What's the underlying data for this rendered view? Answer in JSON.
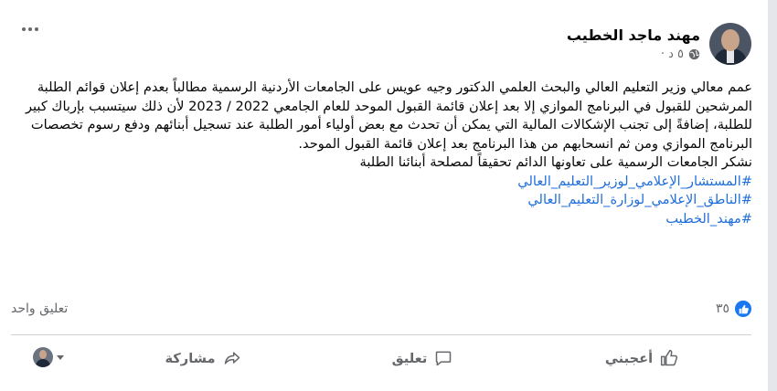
{
  "post": {
    "author": "مهند ماجد الخطيب",
    "time": "٥ د ·",
    "paragraph1": "عمم معالي وزير التعليم العالي والبحث العلمي الدكتور وجيه عويس على الجامعات الأردنية الرسمية مطالباً بعدم إعلان قوائم الطلبة المرشحين للقبول في البرنامج الموازي إلا بعد إعلان قائمة القبول الموحد للعام الجامعي 2022 / 2023 لأن ذلك سيتسبب بإرباك كبير للطلبة، إضافةً إلى تجنب الإشكالات المالية التي يمكن أن تحدث مع بعض أولياء أمور الطلبة عند تسجيل أبنائهم ودفع رسوم تخصصات البرنامج الموازي ومن ثم انسحابهم من هذا البرنامج بعد إعلان قائمة القبول الموحد.",
    "paragraph2": "نشكر الجامعات الرسمية على تعاونها الدائم تحقيقاً لمصلحة أبنائنا الطلبة",
    "hashtags": [
      "#المستشار_الإعلامي_لوزير_التعليم_العالي",
      "#الناطق_الإعلامي_لوزارة_التعليم_العالي",
      "#مهند_الخطيب"
    ],
    "icons": {
      "privacy": "globe-icon",
      "more": "more-options-icon",
      "reaction": "like-reaction-icon"
    }
  },
  "stats": {
    "likes_count": "٣٥",
    "comments_count": "تعليق واحد"
  },
  "actions": {
    "like": "أعجبني",
    "comment": "تعليق",
    "share": "مشاركة"
  },
  "colors": {
    "accent": "#1877f2",
    "hashtag": "#216fdb",
    "muted": "#65676b",
    "text": "#050505"
  }
}
